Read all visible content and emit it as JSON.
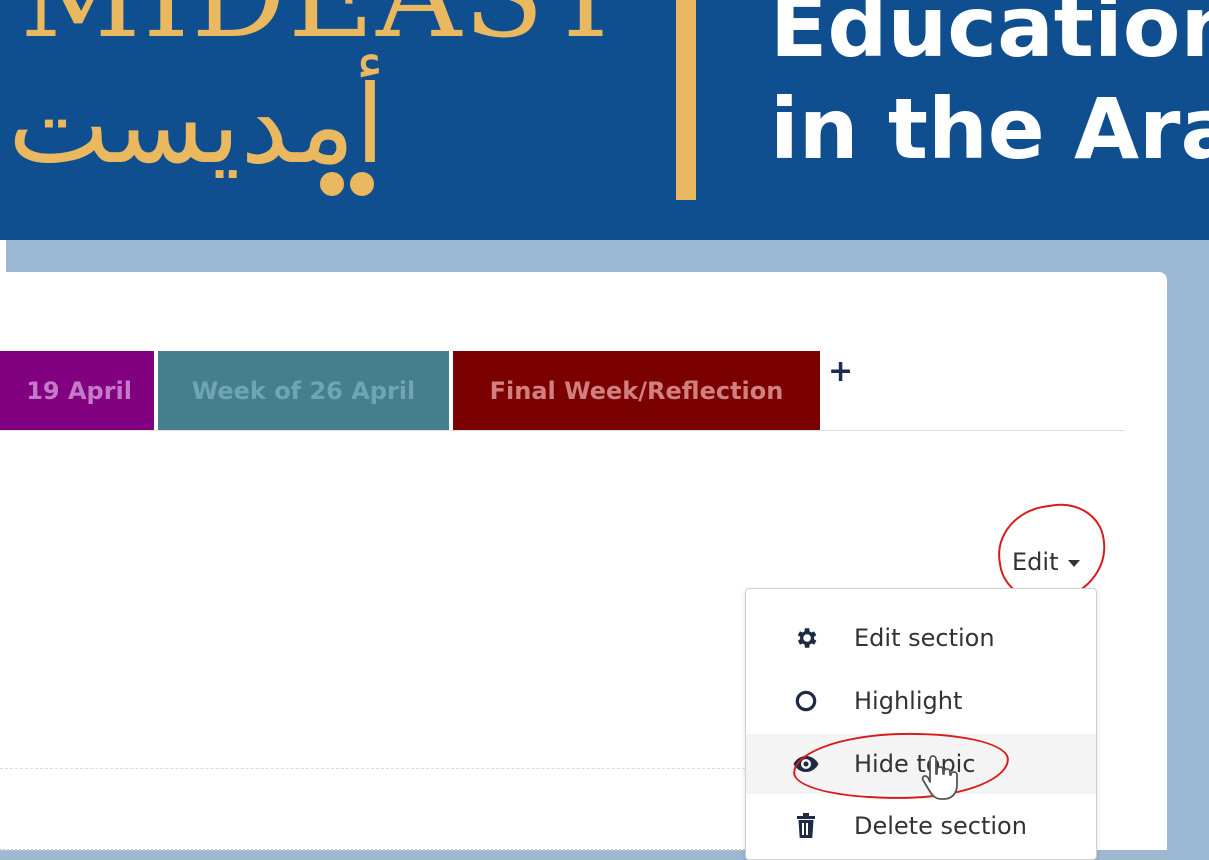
{
  "header": {
    "logo_en": "MIDEAST",
    "logo_ar": "أمديست",
    "title_line1": "Education",
    "title_line2": "in the Ara"
  },
  "tabs": [
    {
      "label": "19 April"
    },
    {
      "label": "Week of 26 April"
    },
    {
      "label": "Final Week/Reflection"
    }
  ],
  "add_tab_label": "+",
  "edit_menu": {
    "toggle_label": "Edit",
    "items": [
      {
        "label": "Edit section",
        "icon": "gear-icon"
      },
      {
        "label": "Highlight",
        "icon": "circle-icon"
      },
      {
        "label": "Hide topic",
        "icon": "eye-icon"
      },
      {
        "label": "Delete section",
        "icon": "trash-icon"
      }
    ]
  },
  "colors": {
    "header_bg": "#0f4f8f",
    "logo_gold": "#eab85f",
    "tab_purple": "#800080",
    "tab_teal": "#457f8c",
    "tab_maroon": "#7b0000",
    "annotation_red": "#d81b1b"
  }
}
